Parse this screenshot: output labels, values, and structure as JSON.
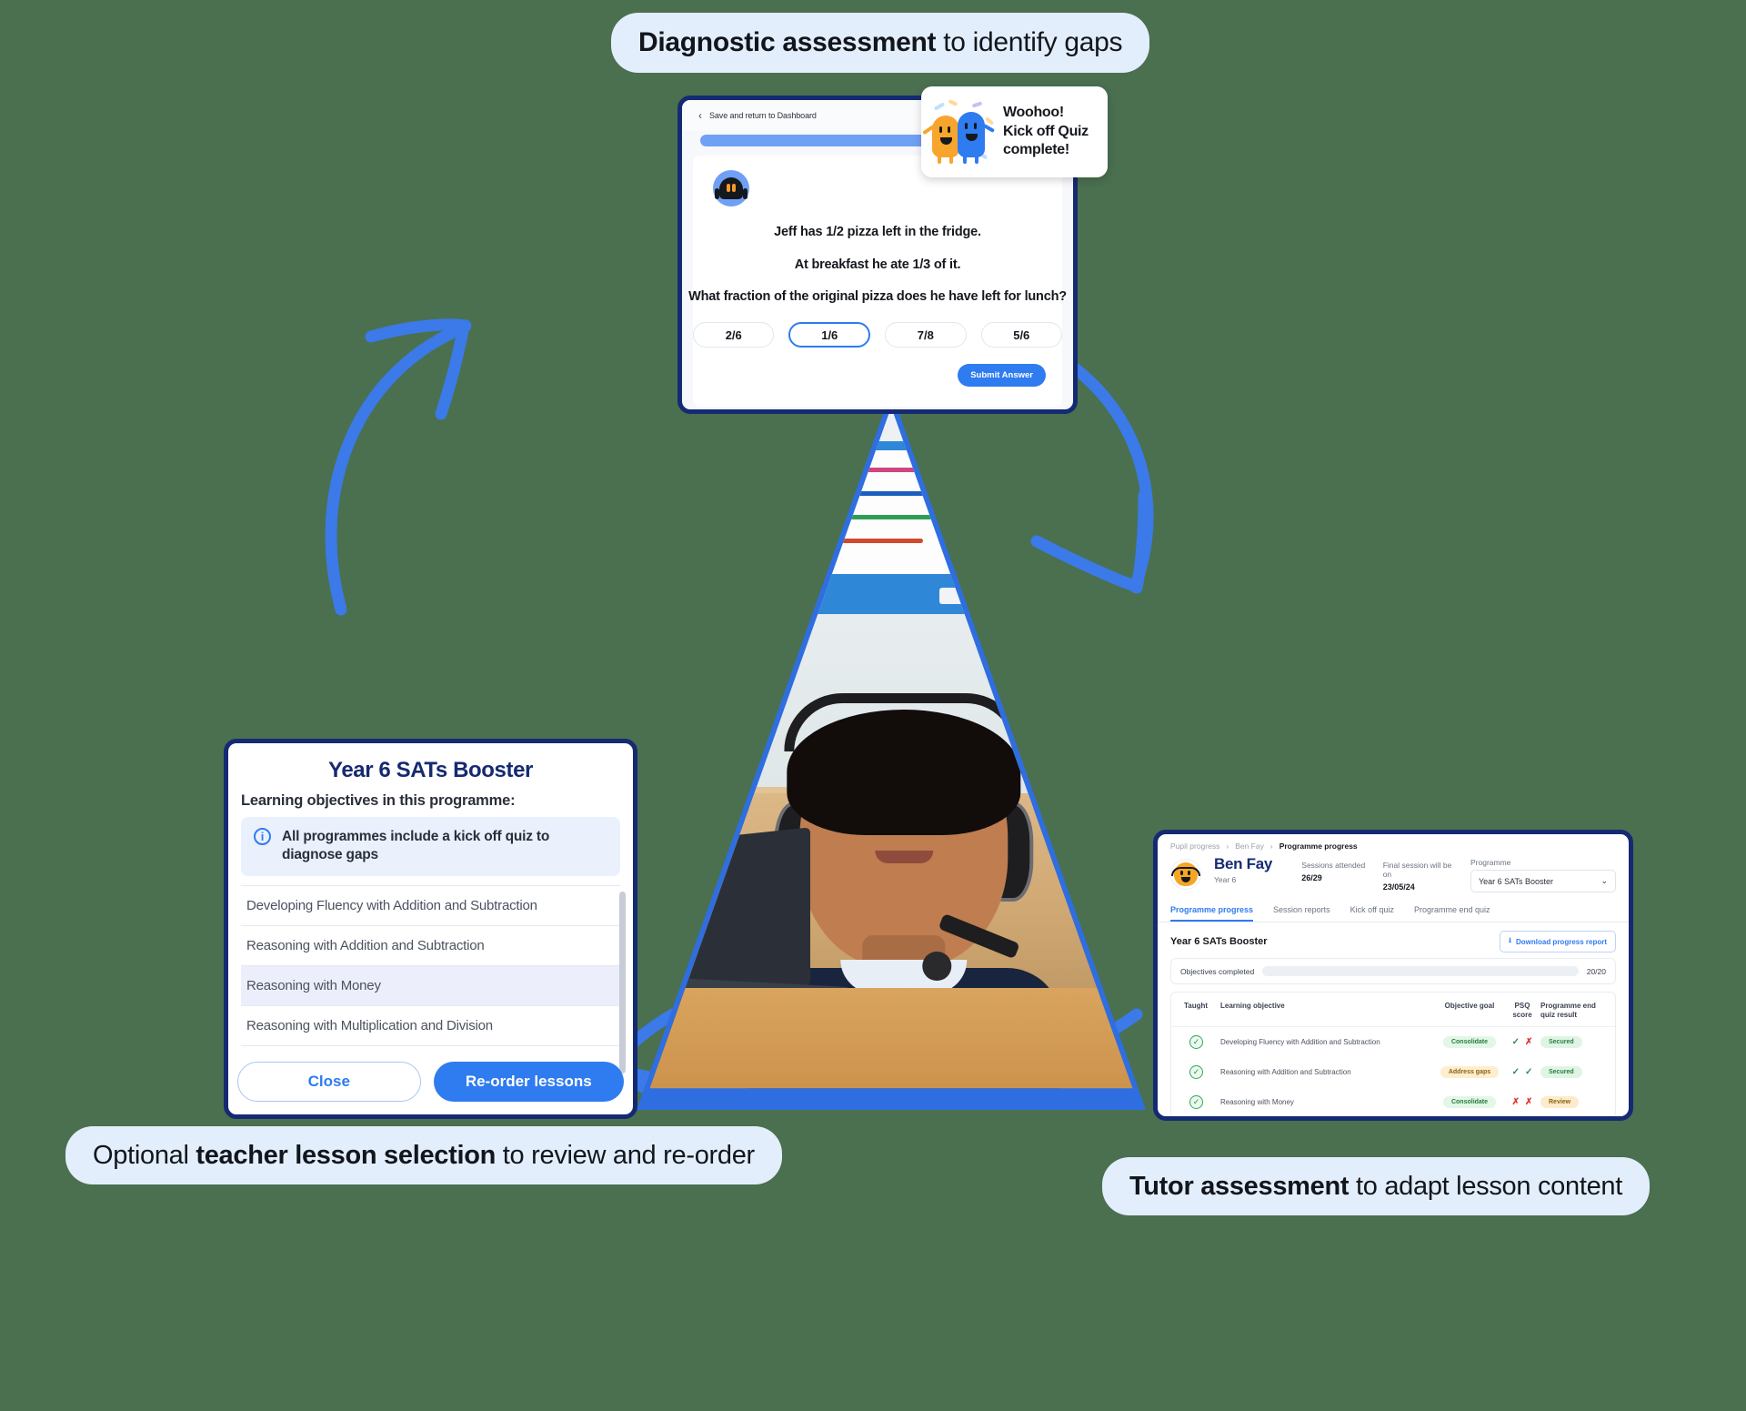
{
  "background_color": "#4a7050",
  "accent_blue": "#2f7bf0",
  "dark_navy": "#152a72",
  "captions": {
    "top": {
      "bold": "Diagnostic assessment",
      "rest": " to identify gaps"
    },
    "bottom_left": {
      "pre": "Optional ",
      "bold": "teacher lesson selection",
      "rest": " to review and re-order"
    },
    "bottom_right": {
      "bold": "Tutor assessment",
      "rest": " to adapt lesson content"
    }
  },
  "quiz": {
    "back_link": "Save and return to Dashboard",
    "question_lines": [
      "Jeff has 1/2 pizza left in the fridge.",
      "At breakfast he ate 1/3 of it.",
      "What fraction of the original pizza does he have left for lunch?"
    ],
    "options": [
      "2/6",
      "1/6",
      "7/8",
      "5/6"
    ],
    "selected_option": "1/6",
    "submit_label": "Submit Answer",
    "avatar_icon": "robot-icon",
    "progress_percent": 100
  },
  "toast": {
    "lines": [
      "Woohoo!",
      "Kick off Quiz",
      "complete!"
    ],
    "illustration": "celebrating-mascots-icon"
  },
  "lessons_modal": {
    "title": "Year 6 SATs Booster",
    "subtitle": "Learning objectives in this programme:",
    "info_icon": "info-icon",
    "info_text": "All programmes include a kick off quiz to diagnose gaps",
    "items": [
      {
        "label": "Developing Fluency with Addition and Subtraction",
        "highlighted": false
      },
      {
        "label": "Reasoning with Addition and Subtraction",
        "highlighted": false
      },
      {
        "label": "Reasoning with Money",
        "highlighted": true
      },
      {
        "label": "Reasoning with Multiplication and Division",
        "highlighted": false
      }
    ],
    "close_label": "Close",
    "reorder_label": "Re-order lessons"
  },
  "dashboard": {
    "breadcrumb": [
      "Pupil progress",
      "Ben Fay",
      "Programme progress"
    ],
    "breadcrumb_separator": "›",
    "pupil": {
      "name": "Ben Fay",
      "year": "Year 6",
      "avatar_icon": "pupil-avatar-icon"
    },
    "stats": [
      {
        "label": "Sessions attended",
        "value": "26/29"
      },
      {
        "label": "Final session will be on",
        "value": "23/05/24"
      }
    ],
    "programme_select": {
      "label": "Programme",
      "value": "Year 6 SATs Booster",
      "chevron": "⌄"
    },
    "tabs": [
      {
        "label": "Programme progress",
        "active": true
      },
      {
        "label": "Session reports",
        "active": false
      },
      {
        "label": "Kick off quiz",
        "active": false
      },
      {
        "label": "Programme end quiz",
        "active": false
      }
    ],
    "programme_title": "Year 6 SATs Booster",
    "download_button": {
      "label": "Download progress report",
      "icon": "download-icon"
    },
    "objectives": {
      "label": "Objectives completed",
      "count": "20/20",
      "percent": 100
    },
    "table": {
      "headers": [
        "Taught",
        "Learning objective",
        "Objective goal",
        "PSQ score",
        "Programme end quiz result"
      ],
      "rows": [
        {
          "taught_icon": "check-circle-icon",
          "objective": "Developing Fluency with Addition and Subtraction",
          "goal": "Consolidate",
          "goal_tone": "green",
          "psq": [
            "tick",
            "cross"
          ],
          "result": "Secured",
          "result_tone": "green"
        },
        {
          "taught_icon": "check-circle-icon",
          "objective": "Reasoning with Addition and Subtraction",
          "goal": "Address gaps",
          "goal_tone": "amber",
          "psq": [
            "tick",
            "tick"
          ],
          "result": "Secured",
          "result_tone": "green"
        },
        {
          "taught_icon": "check-circle-icon",
          "objective": "Reasoning with Money",
          "goal": "Consolidate",
          "goal_tone": "green",
          "psq": [
            "cross",
            "cross"
          ],
          "result": "Review",
          "result_tone": "amber"
        }
      ]
    }
  },
  "photo": {
    "description": "pupil-with-headset-photo"
  }
}
